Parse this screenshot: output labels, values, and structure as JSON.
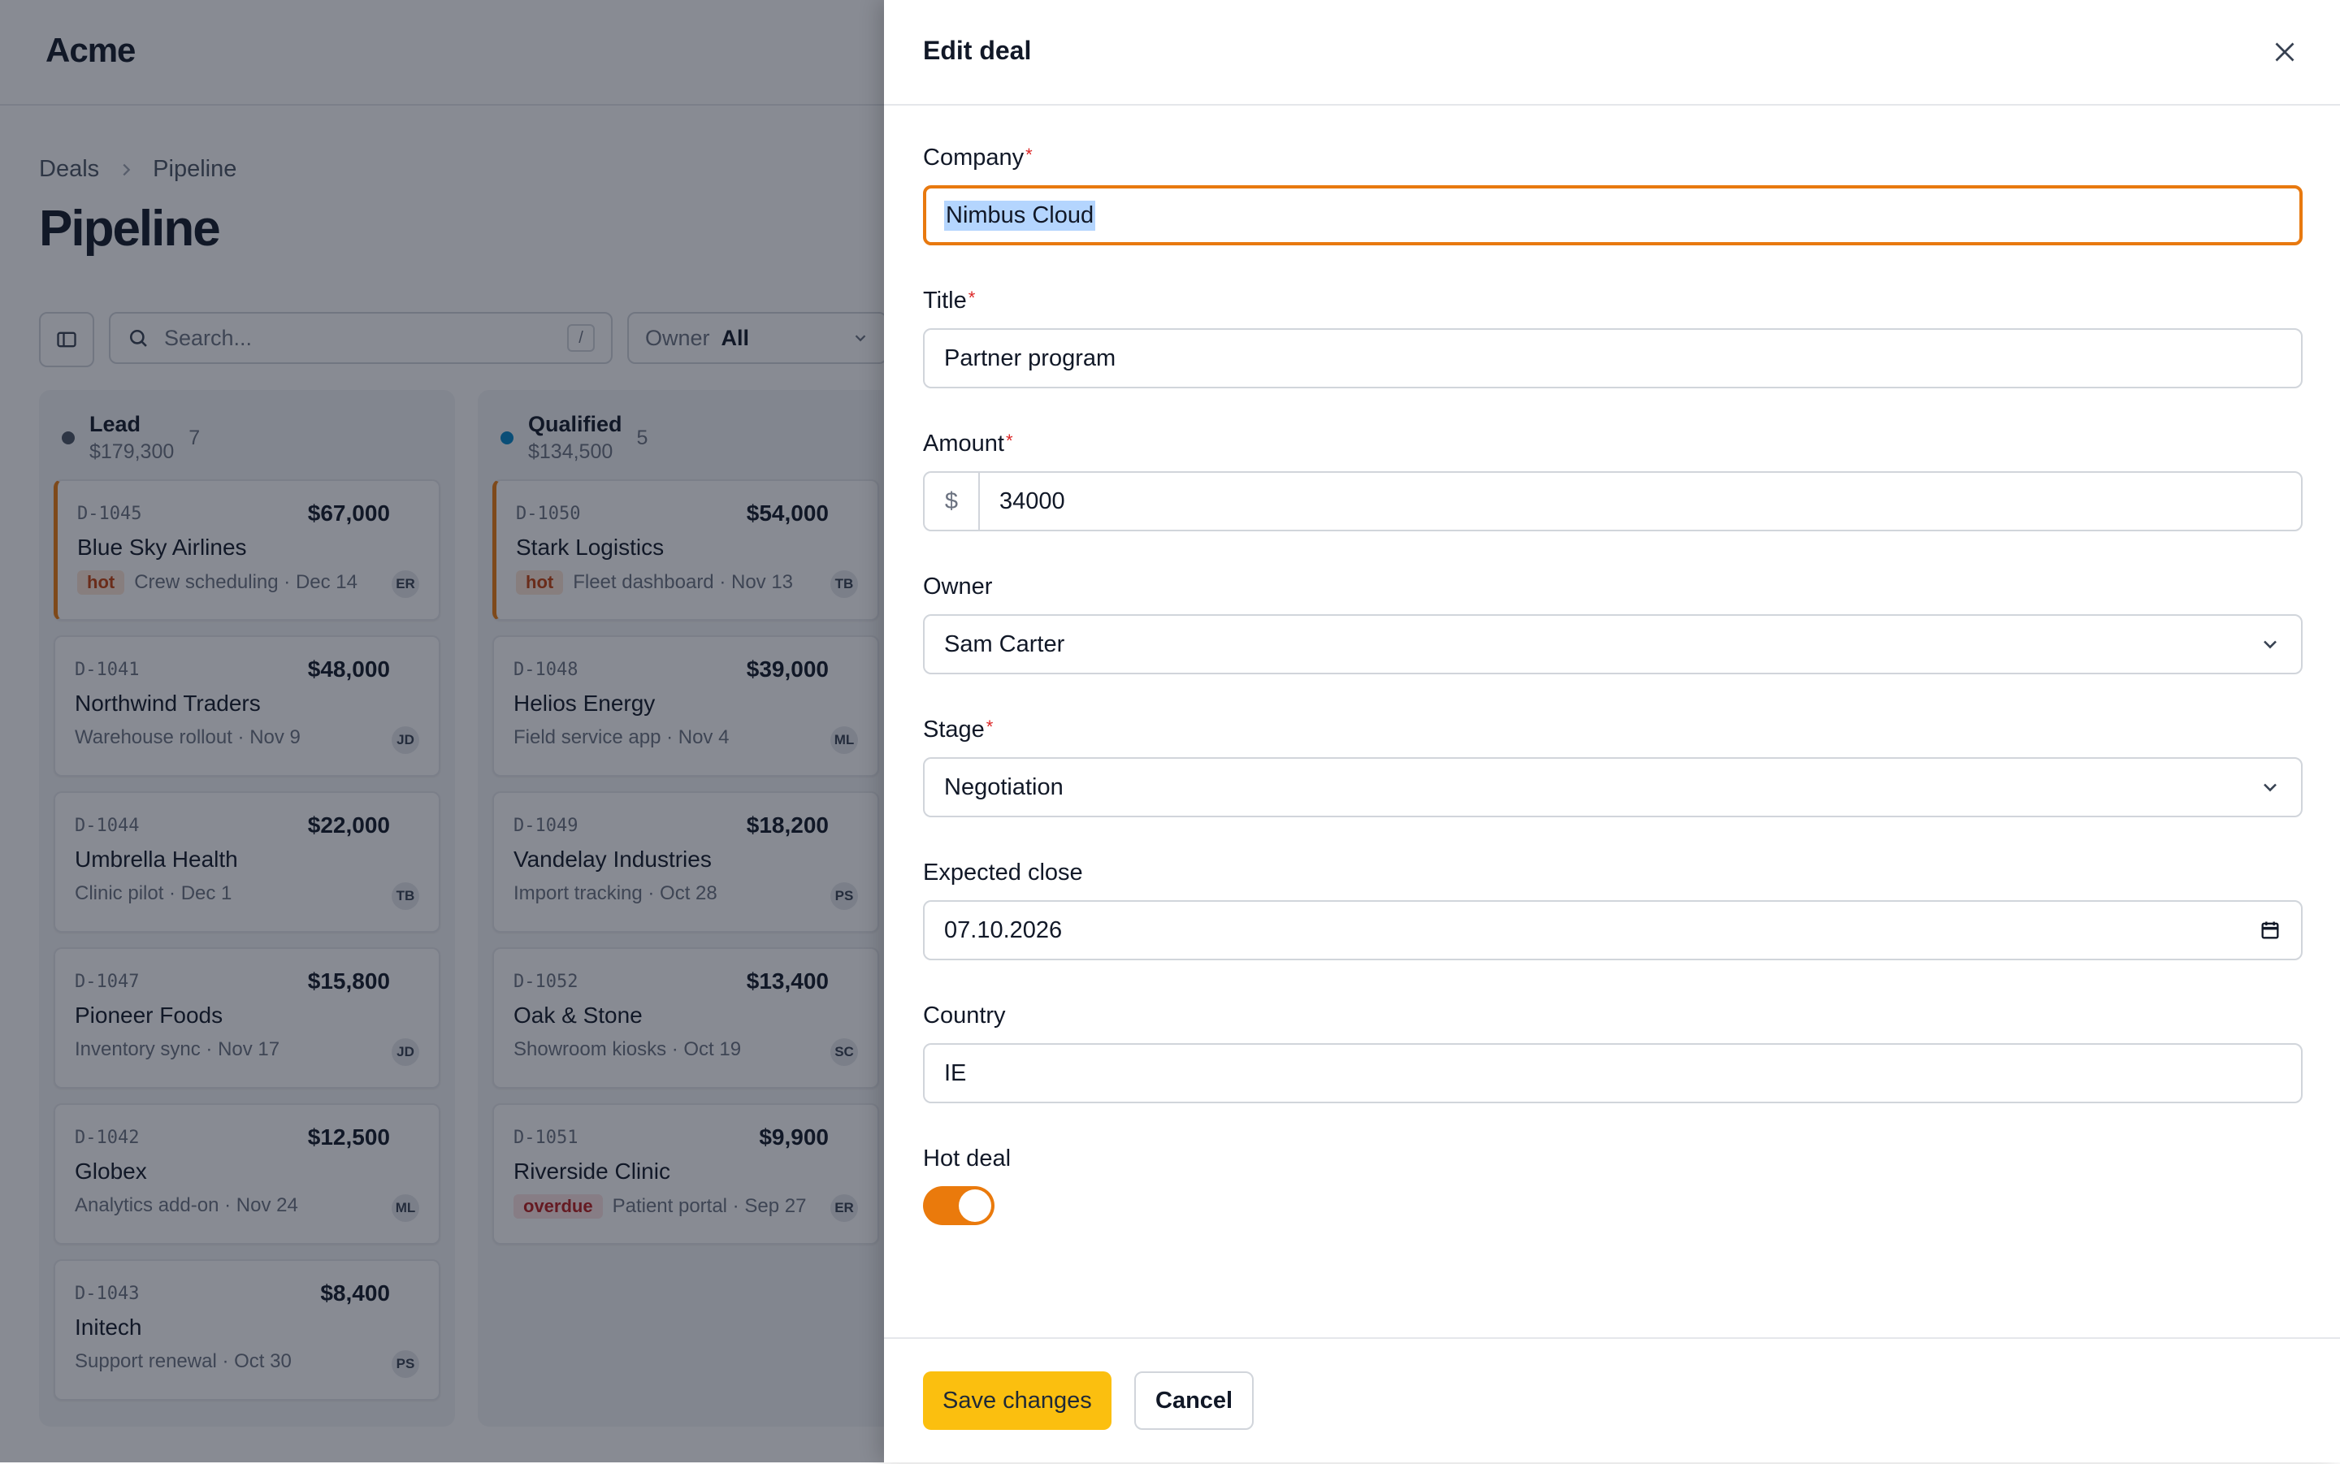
{
  "app": {
    "name": "Acme"
  },
  "breadcrumb": {
    "items": [
      "Deals",
      "Pipeline"
    ]
  },
  "page": {
    "title": "Pipeline"
  },
  "toolbar": {
    "search_placeholder": "Search...",
    "search_shortcut": "/",
    "owner_filter_label": "Owner",
    "owner_filter_value": "All"
  },
  "columns": [
    {
      "name": "Lead",
      "total": "$179,300",
      "count": "7",
      "dot_color": "#4b5563",
      "cards": [
        {
          "id": "D-1045",
          "amount": "$67,000",
          "company": "Blue Sky Airlines",
          "tag": "hot",
          "meta": "Crew scheduling · Dec 14",
          "owner": "ER"
        },
        {
          "id": "D-1041",
          "amount": "$48,000",
          "company": "Northwind Traders",
          "tag": "",
          "meta": "Warehouse rollout · Nov 9",
          "owner": "JD"
        },
        {
          "id": "D-1044",
          "amount": "$22,000",
          "company": "Umbrella Health",
          "tag": "",
          "meta": "Clinic pilot · Dec 1",
          "owner": "TB"
        },
        {
          "id": "D-1047",
          "amount": "$15,800",
          "company": "Pioneer Foods",
          "tag": "",
          "meta": "Inventory sync · Nov 17",
          "owner": "JD"
        },
        {
          "id": "D-1042",
          "amount": "$12,500",
          "company": "Globex",
          "tag": "",
          "meta": "Analytics add-on · Nov 24",
          "owner": "ML"
        },
        {
          "id": "D-1043",
          "amount": "$8,400",
          "company": "Initech",
          "tag": "",
          "meta": "Support renewal · Oct 30",
          "owner": "PS"
        }
      ]
    },
    {
      "name": "Qualified",
      "total": "$134,500",
      "count": "5",
      "dot_color": "#0284c7",
      "cards": [
        {
          "id": "D-1050",
          "amount": "$54,000",
          "company": "Stark Logistics",
          "tag": "hot",
          "meta": "Fleet dashboard · Nov 13",
          "owner": "TB"
        },
        {
          "id": "D-1048",
          "amount": "$39,000",
          "company": "Helios Energy",
          "tag": "",
          "meta": "Field service app · Nov 4",
          "owner": "ML"
        },
        {
          "id": "D-1049",
          "amount": "$18,200",
          "company": "Vandelay Industries",
          "tag": "",
          "meta": "Import tracking · Oct 28",
          "owner": "PS"
        },
        {
          "id": "D-1052",
          "amount": "$13,400",
          "company": "Oak & Stone",
          "tag": "",
          "meta": "Showroom kiosks · Oct 19",
          "owner": "SC"
        },
        {
          "id": "D-1051",
          "amount": "$9,900",
          "company": "Riverside Clinic",
          "tag": "overdue",
          "meta": "Patient portal · Sep 27",
          "owner": "ER"
        }
      ]
    }
  ],
  "drawer": {
    "title": "Edit deal",
    "fields": {
      "company": {
        "label": "Company",
        "value": "Nimbus Cloud",
        "required": "*"
      },
      "title": {
        "label": "Title",
        "value": "Partner program",
        "required": "*"
      },
      "amount": {
        "label": "Amount",
        "prefix": "$",
        "value": "34000",
        "required": "*"
      },
      "owner": {
        "label": "Owner",
        "value": "Sam Carter"
      },
      "stage": {
        "label": "Stage",
        "value": "Negotiation",
        "required": "*"
      },
      "expected_close": {
        "label": "Expected close",
        "value": "07.10.2026"
      },
      "country": {
        "label": "Country",
        "value": "IE"
      },
      "hot_deal": {
        "label": "Hot deal",
        "on": true
      }
    },
    "save_label": "Save changes",
    "cancel_label": "Cancel"
  },
  "colors": {
    "accent": "#ea7a0c",
    "primary_button": "#fbbf0f",
    "required": "#dc2626"
  }
}
